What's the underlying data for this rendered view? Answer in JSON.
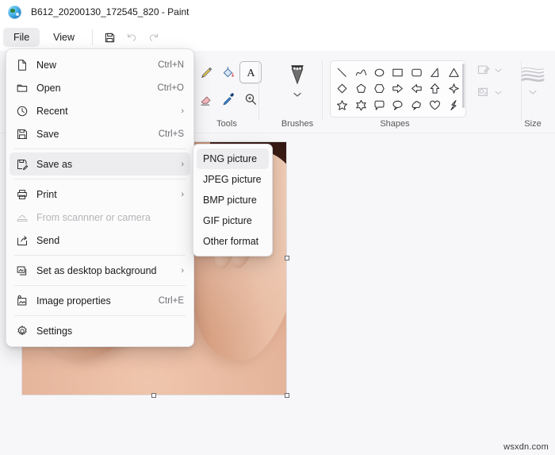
{
  "window": {
    "title": "B612_20200130_172545_820 - Paint",
    "app_icon": "paint-palette-icon"
  },
  "tabbar": {
    "tabs": [
      {
        "label": "File",
        "active": true
      },
      {
        "label": "View",
        "active": false
      }
    ],
    "quick_access": [
      {
        "name": "save-icon",
        "label": "Save",
        "disabled": false
      },
      {
        "name": "undo-icon",
        "label": "Undo",
        "disabled": true
      },
      {
        "name": "redo-icon",
        "label": "Redo",
        "disabled": true
      }
    ]
  },
  "ribbon": {
    "groups": [
      {
        "name": "tools",
        "label": "Tools"
      },
      {
        "name": "brushes",
        "label": "Brushes"
      },
      {
        "name": "shapes",
        "label": "Shapes"
      },
      {
        "name": "size",
        "label": "Size"
      }
    ],
    "tools": [
      {
        "name": "pencil-icon",
        "label": "Pencil",
        "selected": false
      },
      {
        "name": "fill-bucket-icon",
        "label": "Fill with color",
        "selected": false
      },
      {
        "name": "text-icon",
        "label": "Text",
        "selected": true
      },
      {
        "name": "eraser-icon",
        "label": "Eraser",
        "selected": false
      },
      {
        "name": "eyedropper-icon",
        "label": "Color picker",
        "selected": false
      },
      {
        "name": "magnifier-icon",
        "label": "Magnifier",
        "selected": false
      }
    ],
    "brushes": {
      "label": "Brushes",
      "icon": "brush-icon",
      "chevron": "chevron-down-icon"
    },
    "shapes": [
      "line",
      "curve",
      "oval",
      "rectangle",
      "rounded-rectangle",
      "right-triangle",
      "triangle",
      "diamond",
      "pentagon",
      "hexagon",
      "right-arrow",
      "left-arrow",
      "up-arrow",
      "four-point-star",
      "five-point-star",
      "six-point-star",
      "rounded-callout",
      "oval-callout",
      "cloud-callout",
      "heart",
      "lightning"
    ],
    "shape_props": [
      {
        "name": "outline-dropdown",
        "label": "Outline",
        "chevron": "chevron-down-icon"
      },
      {
        "name": "fill-dropdown",
        "label": "Fill",
        "chevron": "chevron-down-icon"
      }
    ],
    "size": {
      "label": "Size",
      "icon": "line-width-icon",
      "chevron": "chevron-down-icon"
    }
  },
  "file_menu": {
    "items": [
      {
        "icon": "new-file-icon",
        "label": "New",
        "accel": "Ctrl+N",
        "arrow": "",
        "highlighted": false,
        "disabled": false
      },
      {
        "icon": "folder-open-icon",
        "label": "Open",
        "accel": "Ctrl+O",
        "arrow": "",
        "highlighted": false,
        "disabled": false
      },
      {
        "icon": "clock-icon",
        "label": "Recent",
        "accel": "",
        "arrow": "›",
        "highlighted": false,
        "disabled": false
      },
      {
        "icon": "save-disk-icon",
        "label": "Save",
        "accel": "Ctrl+S",
        "arrow": "",
        "highlighted": false,
        "disabled": false
      },
      {
        "icon": "save-as-icon",
        "label": "Save as",
        "accel": "",
        "arrow": "›",
        "highlighted": true,
        "disabled": false
      },
      {
        "icon": "printer-icon",
        "label": "Print",
        "accel": "",
        "arrow": "›",
        "highlighted": false,
        "disabled": false
      },
      {
        "icon": "scanner-icon",
        "label": "From scannner or camera",
        "accel": "",
        "arrow": "",
        "highlighted": false,
        "disabled": true
      },
      {
        "icon": "send-share-icon",
        "label": "Send",
        "accel": "",
        "arrow": "",
        "highlighted": false,
        "disabled": false
      },
      {
        "icon": "desktop-background-icon",
        "label": "Set as desktop background",
        "accel": "",
        "arrow": "›",
        "highlighted": false,
        "disabled": false
      },
      {
        "icon": "image-properties-icon",
        "label": "Image properties",
        "accel": "Ctrl+E",
        "arrow": "",
        "highlighted": false,
        "disabled": false
      },
      {
        "icon": "gear-icon",
        "label": "Settings",
        "accel": "",
        "arrow": "",
        "highlighted": false,
        "disabled": false
      }
    ],
    "separator_after": [
      3,
      5,
      7,
      8,
      9
    ]
  },
  "save_as_submenu": {
    "items": [
      {
        "label": "PNG picture",
        "highlighted": true
      },
      {
        "label": "JPEG picture",
        "highlighted": false
      },
      {
        "label": "BMP picture",
        "highlighted": false
      },
      {
        "label": "GIF picture",
        "highlighted": false
      },
      {
        "label": "Other format",
        "highlighted": false
      }
    ]
  },
  "canvas": {
    "name": "image-canvas",
    "description": "Photo of a person's neck and shoulder with hands raised near the face",
    "handles": [
      "bottom-center",
      "bottom-right",
      "right-middle"
    ]
  },
  "watermark": {
    "text": "wsxdn.com"
  },
  "colors": {
    "window_bg": "#ffffff",
    "ribbon_bg": "#f7f7f9",
    "menu_bg": "#fbfbfb",
    "highlight": "#ededef",
    "text": "#1a1a1a",
    "muted_text": "#6d6d73",
    "disabled_text": "#b5b5ba",
    "border": "#e0e0e4"
  }
}
